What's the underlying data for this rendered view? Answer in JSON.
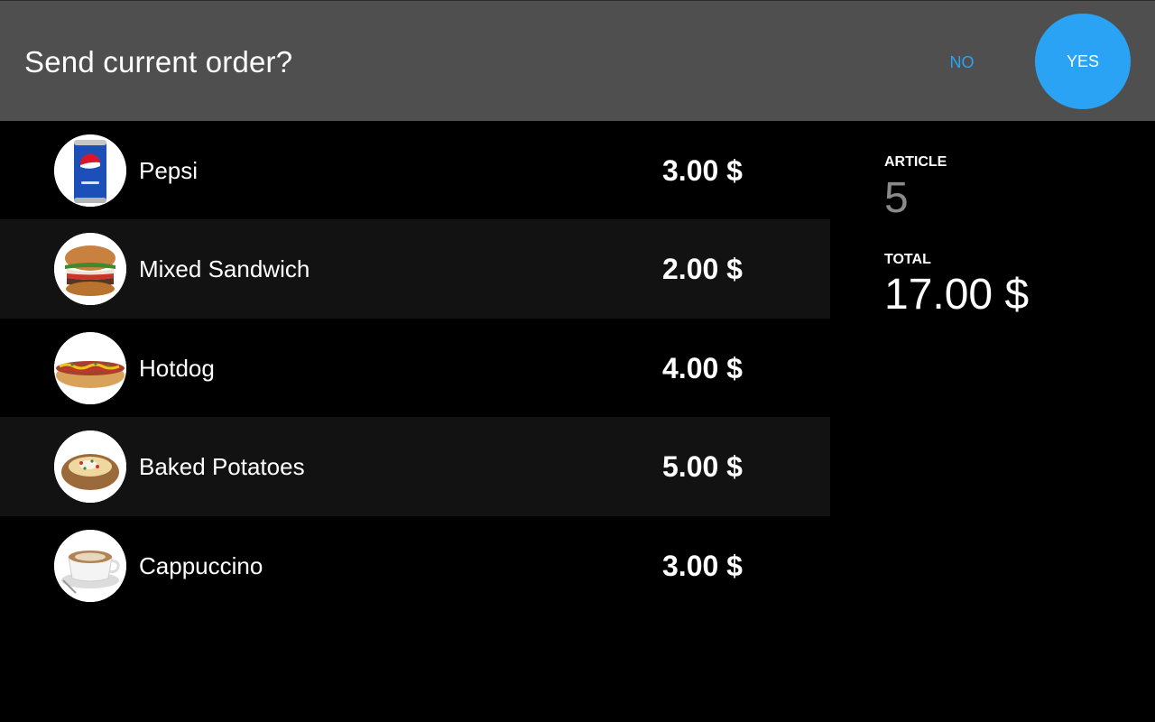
{
  "header": {
    "title": "Send current order?",
    "no_label": "NO",
    "yes_label": "YES"
  },
  "order": {
    "items": [
      {
        "name": "Pepsi",
        "price": "3.00 $",
        "icon": "pepsi-can-icon"
      },
      {
        "name": "Mixed Sandwich",
        "price": "2.00 $",
        "icon": "sandwich-icon"
      },
      {
        "name": "Hotdog",
        "price": "4.00 $",
        "icon": "hotdog-icon"
      },
      {
        "name": "Baked Potatoes",
        "price": "5.00 $",
        "icon": "baked-potato-icon"
      },
      {
        "name": "Cappuccino",
        "price": "3.00 $",
        "icon": "cappuccino-icon"
      }
    ]
  },
  "summary": {
    "article_label": "ARTICLE",
    "article_value": "5",
    "total_label": "TOTAL",
    "total_value": "17.00 $"
  },
  "colors": {
    "header_bg": "#4f4f4f",
    "accent": "#2aa3f5",
    "row_alt_bg": "#121212",
    "background": "#000000",
    "muted_text": "#8a8a8a"
  }
}
